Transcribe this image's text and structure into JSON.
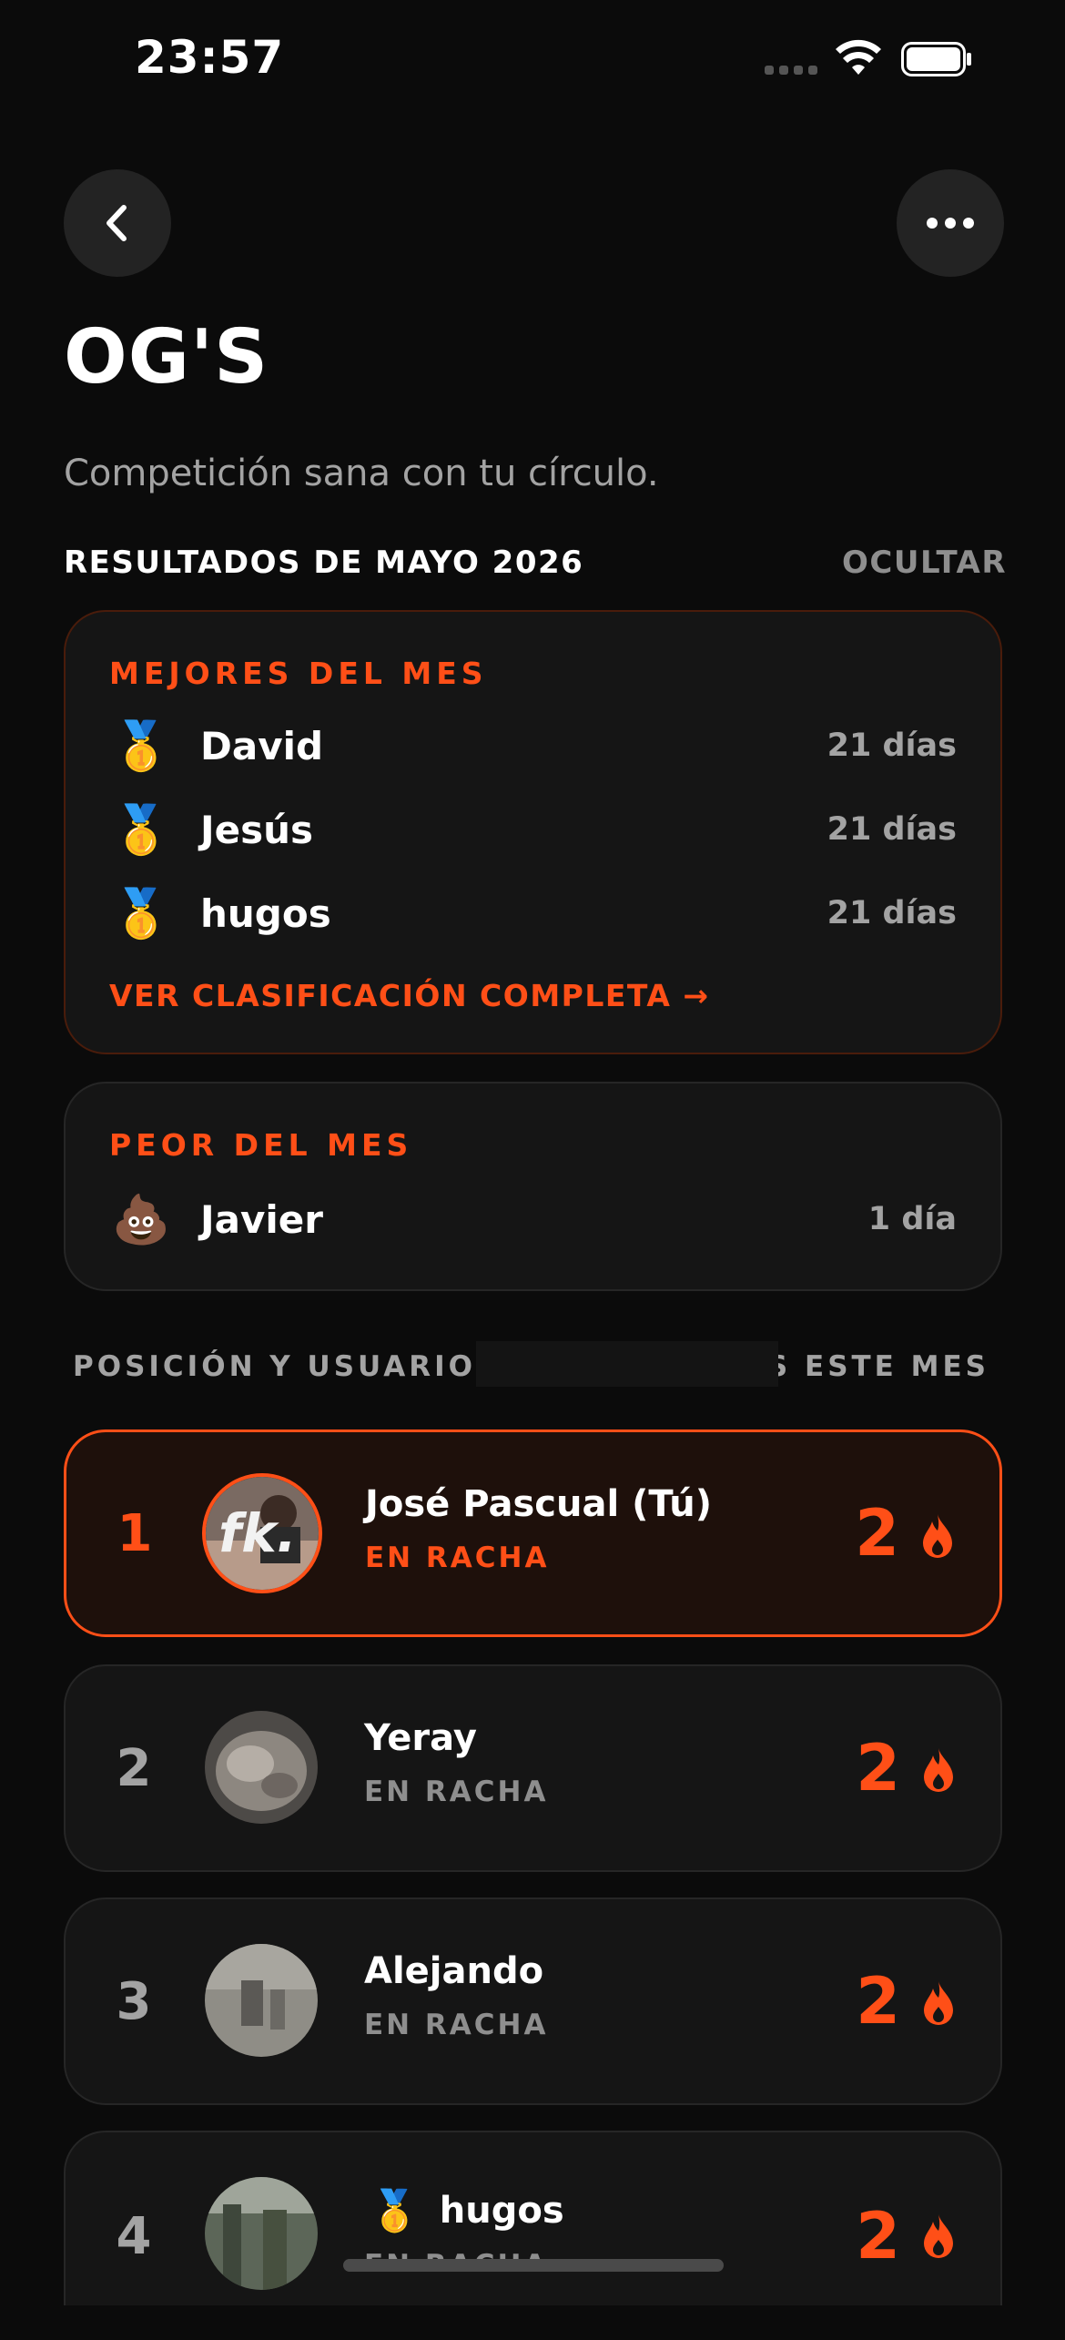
{
  "status_bar": {
    "time": "23:57"
  },
  "header": {
    "title": "OG'S",
    "subtitle": "Competición sana con tu círculo."
  },
  "results": {
    "heading": "RESULTADOS DE MAYO 2026",
    "hide_label": "OCULTAR",
    "best": {
      "label": "MEJORES DEL MES",
      "items": [
        {
          "emoji": "🥇",
          "name": "David",
          "days": "21 días"
        },
        {
          "emoji": "🥇",
          "name": "Jesús",
          "days": "21 días"
        },
        {
          "emoji": "🥇",
          "name": "hugos",
          "days": "21 días"
        }
      ],
      "link": "VER CLASIFICACIÓN COMPLETA →"
    },
    "worst": {
      "label": "PEOR DEL MES",
      "items": [
        {
          "emoji": "💩",
          "name": "Javier",
          "days": "1 día"
        }
      ]
    }
  },
  "leaderboard": {
    "col_left": "POSICIÓN Y USUARIO",
    "col_right": "AS ESTE MES",
    "rows": [
      {
        "rank": "1",
        "name": "José Pascual (Tú)",
        "status": "EN RACHA",
        "score": "2",
        "is_me": true
      },
      {
        "rank": "2",
        "name": "Yeray",
        "status": "EN RACHA",
        "score": "2"
      },
      {
        "rank": "3",
        "name": "Alejando",
        "status": "EN RACHA",
        "score": "2"
      },
      {
        "rank": "4",
        "medal": "🥇",
        "name": "hugos",
        "status": "EN RACHA",
        "score": "2"
      }
    ]
  },
  "colors": {
    "accent": "#ff4f17",
    "background": "#0b0b0b",
    "card": "#151515"
  }
}
